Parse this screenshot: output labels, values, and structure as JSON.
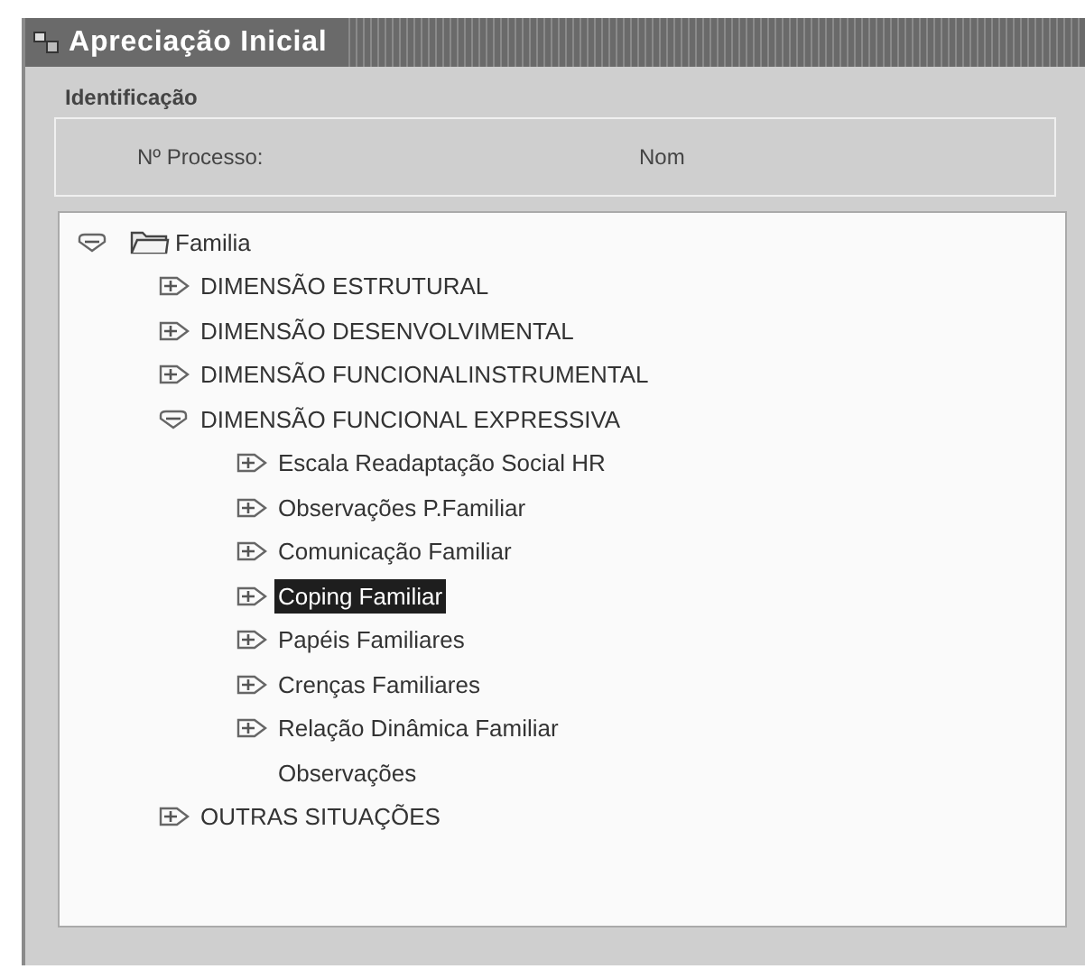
{
  "window": {
    "title": "Apreciação Inicial"
  },
  "identification": {
    "legend": "Identificação",
    "fields": [
      {
        "label": "Nº Processo:"
      },
      {
        "label": "Nom"
      }
    ]
  },
  "tree": [
    {
      "label": "Familia",
      "kind": "folder",
      "expanded": true,
      "selected": false,
      "children": [
        {
          "label": "DIMENSÃO ESTRUTURAL",
          "kind": "node",
          "expanded": false,
          "selected": false
        },
        {
          "label": "DIMENSÃO DESENVOLVIMENTAL",
          "kind": "node",
          "expanded": false,
          "selected": false
        },
        {
          "label": "DIMENSÃO FUNCIONALINSTRUMENTAL",
          "kind": "node",
          "expanded": false,
          "selected": false
        },
        {
          "label": "DIMENSÃO FUNCIONAL EXPRESSIVA",
          "kind": "node",
          "expanded": true,
          "selected": false,
          "children": [
            {
              "label": "Escala Readaptação Social HR",
              "kind": "node",
              "expanded": false,
              "selected": false
            },
            {
              "label": "Observações P.Familiar",
              "kind": "node",
              "expanded": false,
              "selected": false
            },
            {
              "label": "Comunicação Familiar",
              "kind": "node",
              "expanded": false,
              "selected": false
            },
            {
              "label": "Coping Familiar",
              "kind": "node",
              "expanded": false,
              "selected": true
            },
            {
              "label": "Papéis Familiares",
              "kind": "node",
              "expanded": false,
              "selected": false
            },
            {
              "label": "Crenças Familiares",
              "kind": "node",
              "expanded": false,
              "selected": false
            },
            {
              "label": "Relação Dinâmica Familiar",
              "kind": "node",
              "expanded": false,
              "selected": false
            },
            {
              "label": "Observações",
              "kind": "leaf",
              "selected": false
            }
          ]
        },
        {
          "label": "OUTRAS SITUAÇÕES",
          "kind": "node",
          "expanded": false,
          "selected": false
        }
      ]
    }
  ]
}
